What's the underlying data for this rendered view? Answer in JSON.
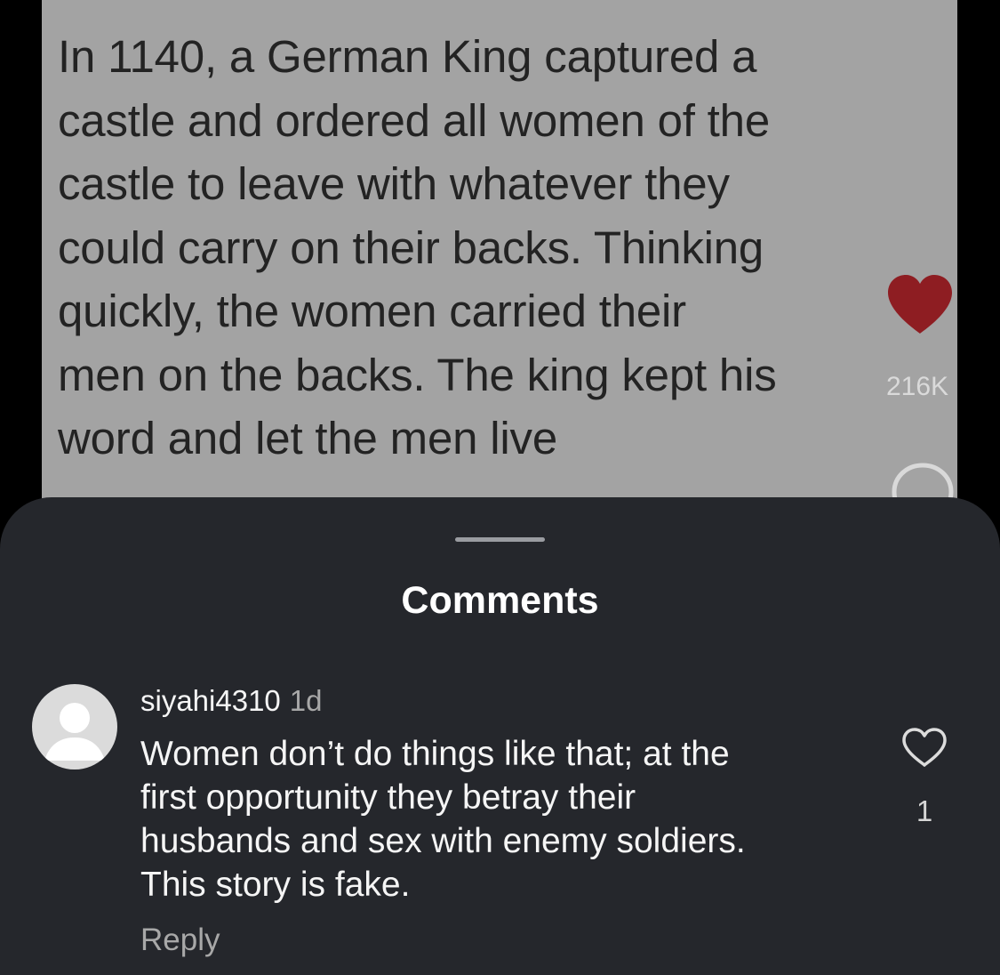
{
  "post": {
    "text_lines": [
      "In 1140, a German King captured a",
      "castle and ordered all women of the",
      "castle to leave with whatever they",
      "could carry on their backs. Thinking",
      "quickly, the women carried their",
      "men on the backs. The king kept his",
      "word and let the men live"
    ],
    "like_count": "216K",
    "like_color": "#8e1d22"
  },
  "comments_sheet": {
    "title": "Comments",
    "comment": {
      "username": "siyahi4310",
      "time": "1d",
      "body_lines": [
        "Women don’t do things like that; at the",
        "first opportunity they betray their",
        "husbands and sex with enemy soldiers.",
        "This story is fake."
      ],
      "reply_label": "Reply",
      "like_count": "1"
    }
  },
  "icons": {
    "post_like": "heart-filled-icon",
    "post_comments": "comment-bubble-icon",
    "comment_like": "heart-outline-icon",
    "avatar": "default-avatar-icon"
  }
}
